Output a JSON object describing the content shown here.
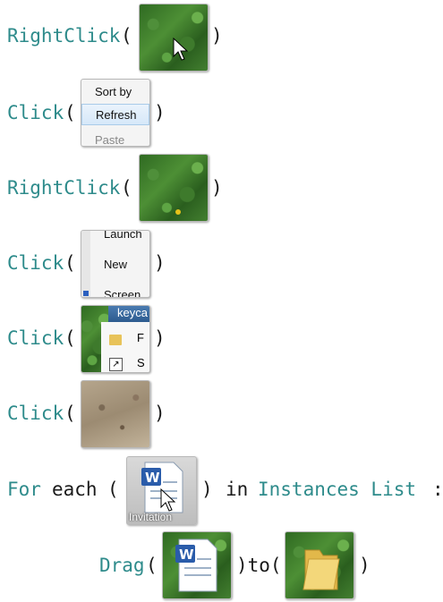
{
  "steps": [
    {
      "keyword": "RightClick",
      "open": "(",
      "close": ")"
    },
    {
      "keyword": "Click",
      "open": "(",
      "close": ")"
    },
    {
      "keyword": "RightClick",
      "open": "(",
      "close": ")"
    },
    {
      "keyword": "Click",
      "open": "(",
      "close": ")"
    },
    {
      "keyword": "Click",
      "open": "(",
      "close": ")"
    },
    {
      "keyword": "Click",
      "open": "(",
      "close": ")"
    }
  ],
  "menu1": {
    "item1": "Sort by",
    "item2": "Refresh",
    "item3": "Paste"
  },
  "menu2": {
    "item1": "Launch",
    "item2": "New",
    "item3": "Screen"
  },
  "window_thumb": {
    "title": "keyca",
    "row1": "F",
    "row2": "S"
  },
  "loop": {
    "for_kw": "For",
    "each_kw": "each",
    "open": "(",
    "close": ")",
    "in_kw": "in",
    "collection": "Instances List",
    "colon": ":",
    "file_label": "Invitation"
  },
  "drag": {
    "keyword": "Drag",
    "open": "(",
    "mid": ")to(",
    "close": ")"
  },
  "colors": {
    "keyword": "#2e8b8b",
    "plain": "#1a1a1a"
  }
}
